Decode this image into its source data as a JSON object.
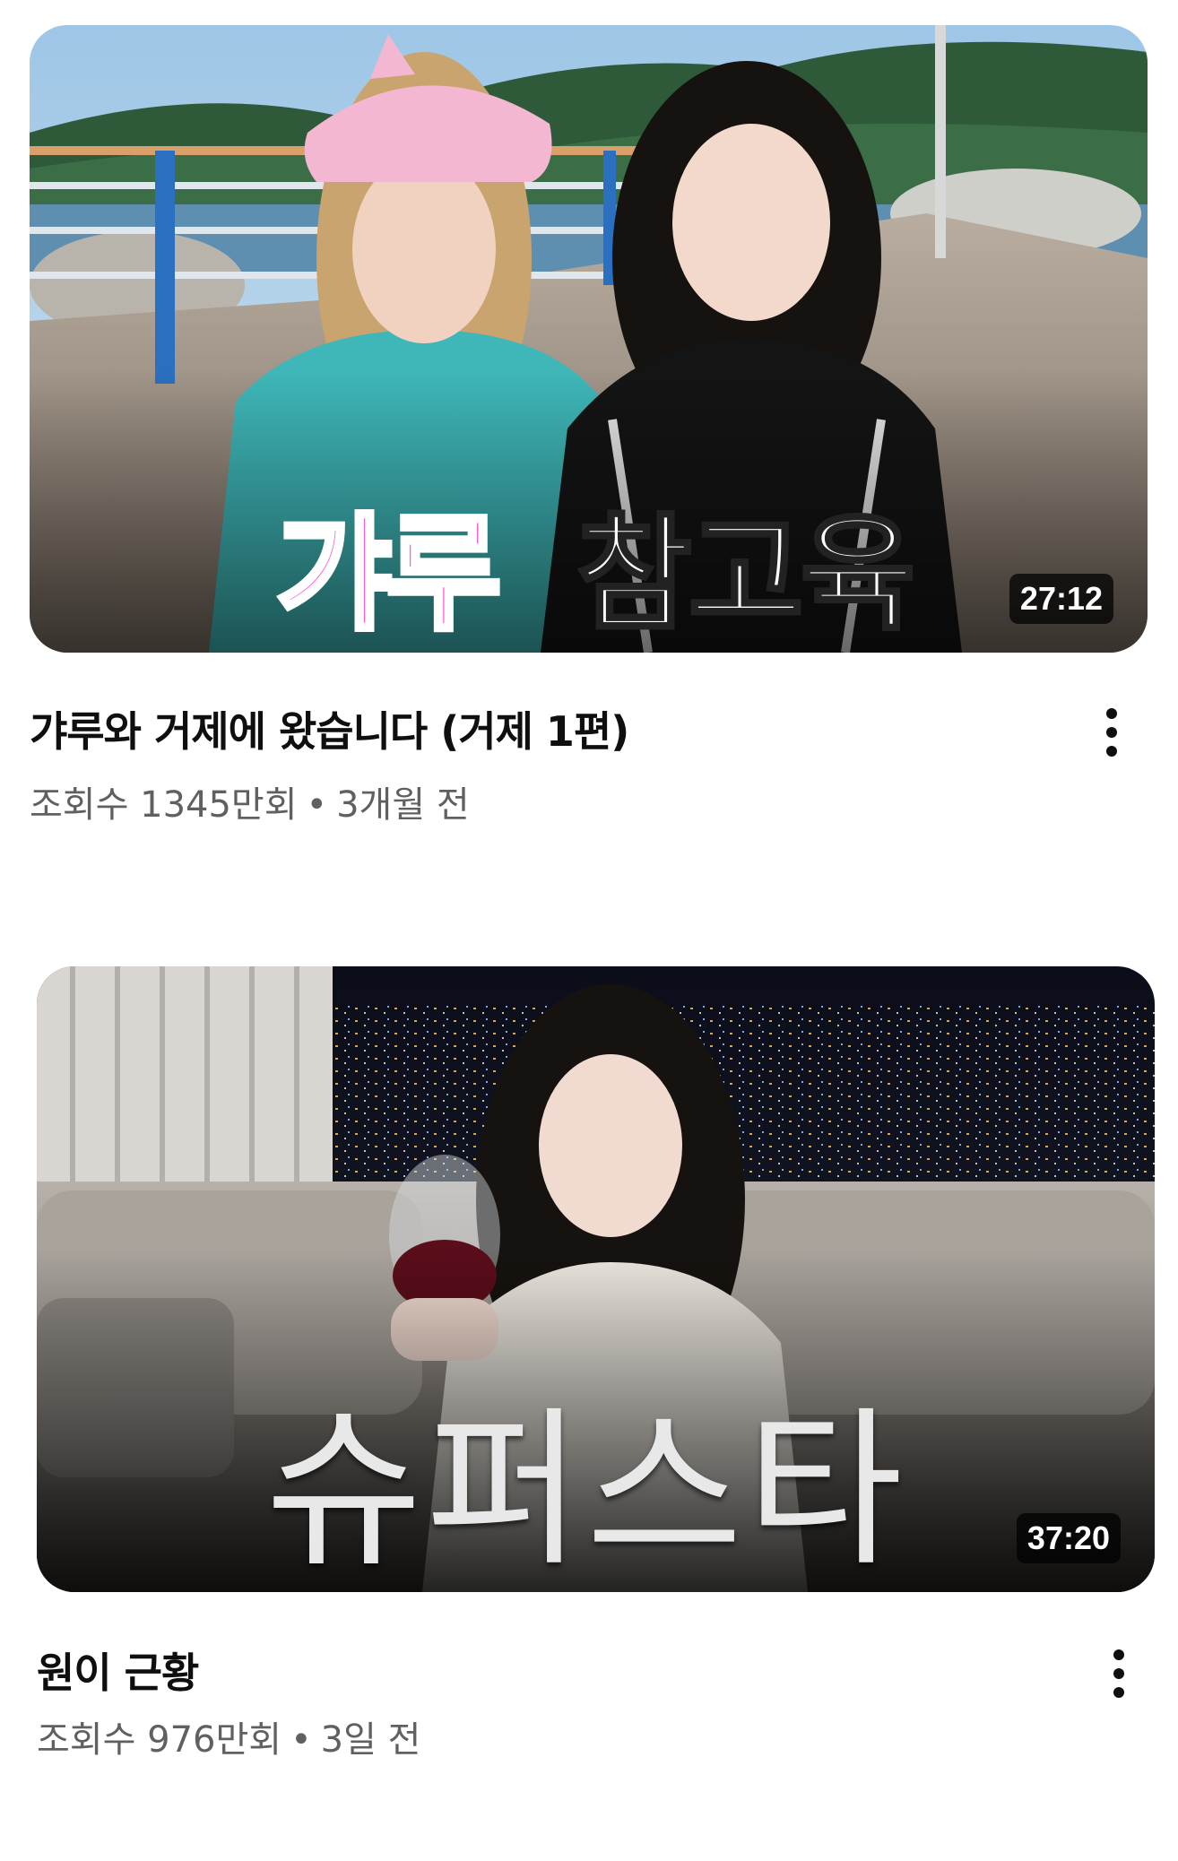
{
  "videos": [
    {
      "thumbnail_text": {
        "pink": "갸루",
        "white": "참고육"
      },
      "duration": "27:12",
      "title": "갸루와 거제에 왔습니다 (거제 1편)",
      "views": "조회수 1345만회",
      "separator": "•",
      "age": "3개월 전",
      "more_icon": "more-vert-icon"
    },
    {
      "thumbnail_text": {
        "silver": "슈퍼스타"
      },
      "duration": "37:20",
      "title": "원이 근황",
      "views": "조회수 976만회",
      "separator": "•",
      "age": "3일 전",
      "more_icon": "more-vert-icon"
    }
  ],
  "colors": {
    "title_text": "#0f0f0f",
    "meta_text": "#606060",
    "thumb_pink_text": "#ff5ad1",
    "duration_bg": "#000000b8"
  }
}
